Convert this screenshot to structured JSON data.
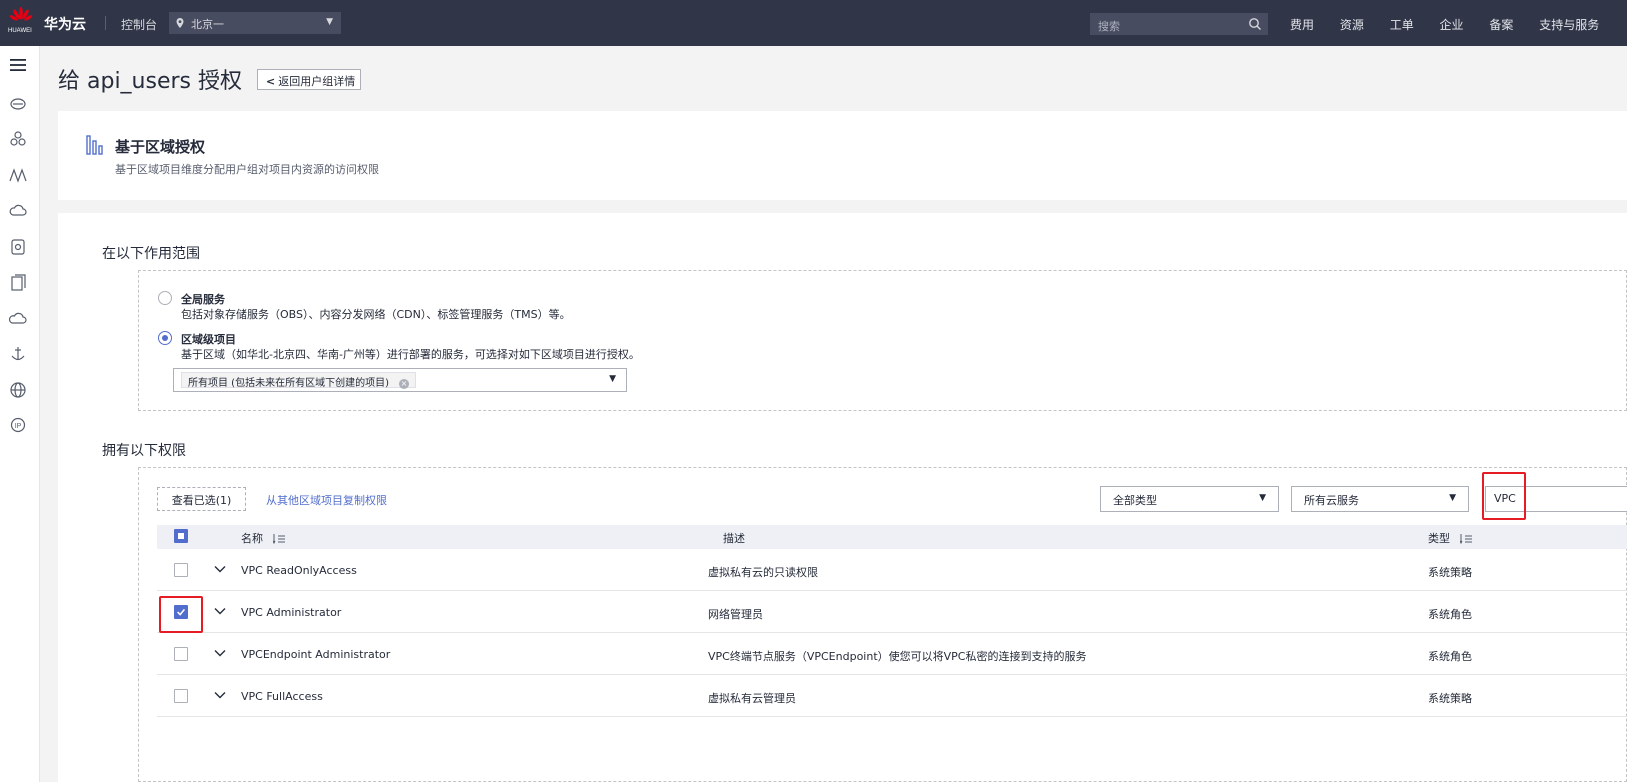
{
  "header": {
    "logo_text": "HUAWEI",
    "brand": "华为云",
    "console": "控制台",
    "region": "北京一",
    "search_placeholder": "搜索",
    "nav": [
      "费用",
      "资源",
      "工单",
      "企业",
      "备案",
      "支持与服务"
    ]
  },
  "sidebar": {
    "icons": [
      "menu-icon",
      "cloud-service-icon",
      "cluster-icon",
      "mountain-icon",
      "cloud-icon",
      "database-icon",
      "document-icon",
      "cloud-outline-icon",
      "anchor-icon",
      "globe-icon",
      "ip-icon"
    ]
  },
  "page": {
    "title": "给 api_users 授权",
    "back_label": "返回用户组详情"
  },
  "info": {
    "title": "基于区域授权",
    "desc": "基于区域项目维度分配用户组对项目内资源的访问权限"
  },
  "scope": {
    "title": "在以下作用范围",
    "options": [
      {
        "title": "全局服务",
        "desc": "包括对象存储服务（OBS）、内容分发网络（CDN）、标签管理服务（TMS）等。",
        "selected": false
      },
      {
        "title": "区域级项目",
        "desc": "基于区域（如华北-北京四、华南-广州等）进行部署的服务，可选择对如下区域项目进行授权。",
        "selected": true
      }
    ],
    "project_tag": "所有项目 (包括未来在所有区域下创建的项目)"
  },
  "permissions": {
    "title": "拥有以下权限",
    "view_selected": "查看已选(1)",
    "copy_link": "从其他区域项目复制权限",
    "type_filter": "全部类型",
    "service_filter": "所有云服务",
    "search_value": "VPC",
    "columns": {
      "name": "名称",
      "desc": "描述",
      "type": "类型"
    },
    "rows": [
      {
        "name": "VPC ReadOnlyAccess",
        "desc": "虚拟私有云的只读权限",
        "type": "系统策略",
        "checked": false
      },
      {
        "name": "VPC Administrator",
        "desc": "网络管理员",
        "type": "系统角色",
        "checked": true
      },
      {
        "name": "VPCEndpoint Administrator",
        "desc": "VPC终端节点服务（VPCEndpoint）使您可以将VPC私密的连接到支持的服务",
        "type": "系统角色",
        "checked": false
      },
      {
        "name": "VPC FullAccess",
        "desc": "虚拟私有云管理员",
        "type": "系统策略",
        "checked": false
      }
    ]
  },
  "colors": {
    "accent": "#526ecc",
    "header_bg": "#303548",
    "highlight": "#e51c23",
    "logo_red": "#e60012"
  }
}
